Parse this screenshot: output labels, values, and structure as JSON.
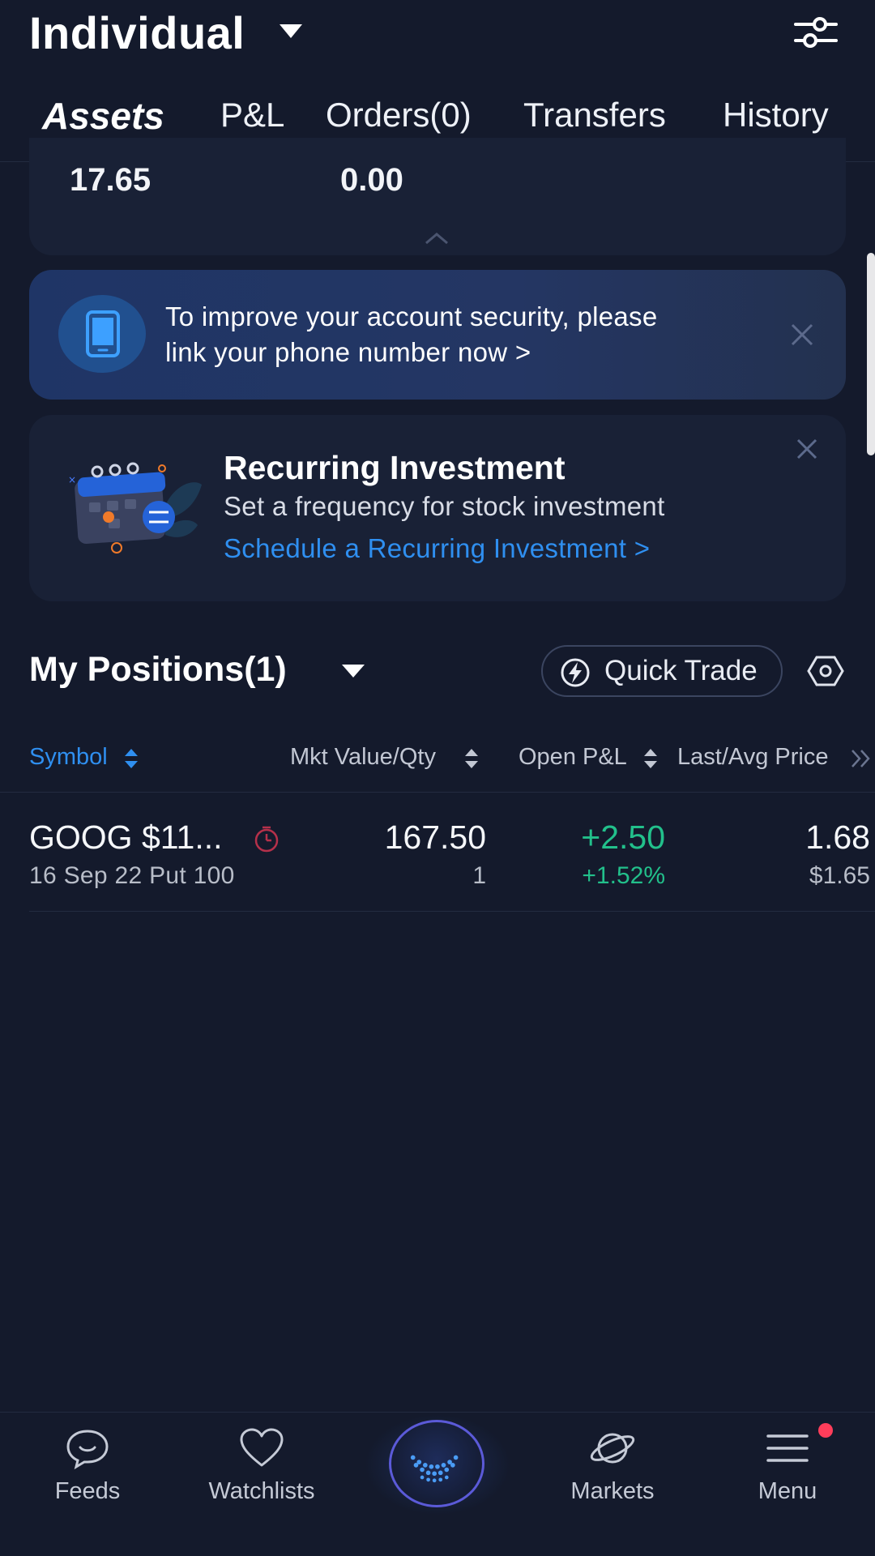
{
  "header": {
    "account_title": "Individual",
    "tabs": [
      {
        "label": "Assets",
        "active": true
      },
      {
        "label": "P&L"
      },
      {
        "label": "Orders(0)"
      },
      {
        "label": "Transfers"
      },
      {
        "label": "History"
      }
    ]
  },
  "summary": {
    "values": [
      "17.65",
      "0.00"
    ]
  },
  "security_banner": {
    "line1": "To improve your account security, please",
    "line2": "link your phone number now >"
  },
  "recurring": {
    "title": "Recurring Investment",
    "subtitle": "Set a frequency for stock investment",
    "link": "Schedule a Recurring Investment >"
  },
  "positions": {
    "title": "My Positions(1)",
    "quick_trade_label": "Quick Trade",
    "columns": [
      "Symbol",
      "Mkt Value/Qty",
      "Open P&L",
      "Last/Avg Price"
    ],
    "rows": [
      {
        "symbol": "GOOG $11...",
        "contract": "16 Sep 22 Put 100",
        "mkt_value": "167.50",
        "qty": "1",
        "open_pnl": "+2.50",
        "open_pnl_pct": "+1.52%",
        "last_price": "1.68",
        "avg_price": "$1.65"
      }
    ]
  },
  "bottom_nav": {
    "items": [
      {
        "label": "Feeds",
        "icon": "chat-bubble-icon"
      },
      {
        "label": "Watchlists",
        "icon": "heart-icon"
      },
      {
        "label": "",
        "icon": "home-logo-icon"
      },
      {
        "label": "Markets",
        "icon": "planet-icon"
      },
      {
        "label": "Menu",
        "icon": "hamburger-menu-icon"
      }
    ]
  },
  "colors": {
    "background": "#141a2c",
    "accent_blue": "#2f8ff0",
    "positive_green": "#22c08b",
    "notification_red": "#ff3d5a"
  }
}
